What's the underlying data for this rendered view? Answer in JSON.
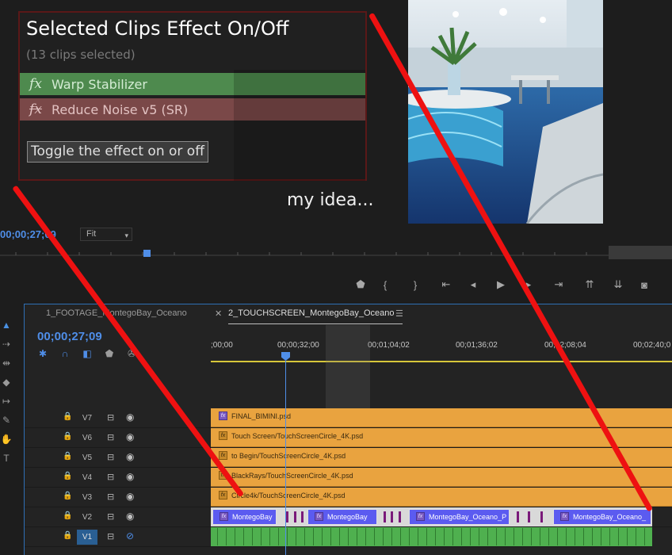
{
  "popup": {
    "title": "Selected Clips Effect On/Off",
    "subtitle": "(13 clips selected)",
    "effects": [
      {
        "name": "Warp Stabilizer",
        "state": "on",
        "icon": "fx-icon"
      },
      {
        "name": "Reduce Noise v5 (SR)",
        "state": "off",
        "icon": "fx-off-icon"
      }
    ],
    "toggle_label": "Toggle the effect on or off"
  },
  "caption": "my idea...",
  "monitor": {
    "timecode": "00;00;27;09",
    "fit": "Fit"
  },
  "transport_icons": [
    "marker-icon",
    "mark-in-icon",
    "mark-out-icon",
    "go-to-in-icon",
    "step-back-icon",
    "play-icon",
    "step-forward-icon",
    "go-to-out-icon",
    "lift-icon",
    "extract-icon",
    "camera-icon"
  ],
  "timeline": {
    "tabs": [
      {
        "label": "1_FOOTAGE_MontegoBay_Oceano",
        "active": false
      },
      {
        "label": "2_TOUCHSCREEN_MontegoBay_Oceano",
        "active": true
      }
    ],
    "timecode": "00;00;27;09",
    "ruler_labels": [
      ";00;00",
      "00;00;32;00",
      "00;01;04;02",
      "00;01;36;02",
      "00;02;08;04",
      "00;02;40;0"
    ],
    "tracks": [
      {
        "name": "V7",
        "clip": "FINAL_BIMINI.psd"
      },
      {
        "name": "V6",
        "clip": "Touch Screen/TouchScreenCircle_4K.psd"
      },
      {
        "name": "V5",
        "clip": "to Begin/TouchScreenCircle_4K.psd"
      },
      {
        "name": "V4",
        "clip": "BlackRays/TouchScreenCircle_4K.psd"
      },
      {
        "name": "V3",
        "clip": "Circle4k/TouchScreenCircle_4K.psd"
      },
      {
        "name": "V2",
        "clip": ""
      },
      {
        "name": "V1",
        "clip": ""
      }
    ],
    "v2_clips": [
      "MontegoBay",
      "MontegoBay",
      "MontegoBay_Oceano_P",
      "MontegoBay_Oceano_"
    ]
  },
  "colors": {
    "accent": "#4f8ee8",
    "effect_on": "#4e8a4e",
    "effect_off": "#7a4848",
    "clip_orange": "#e9a33f",
    "clip_purple": "#5b5bf0",
    "clip_green": "#4fb04f",
    "annotation_red": "#ee1111"
  }
}
